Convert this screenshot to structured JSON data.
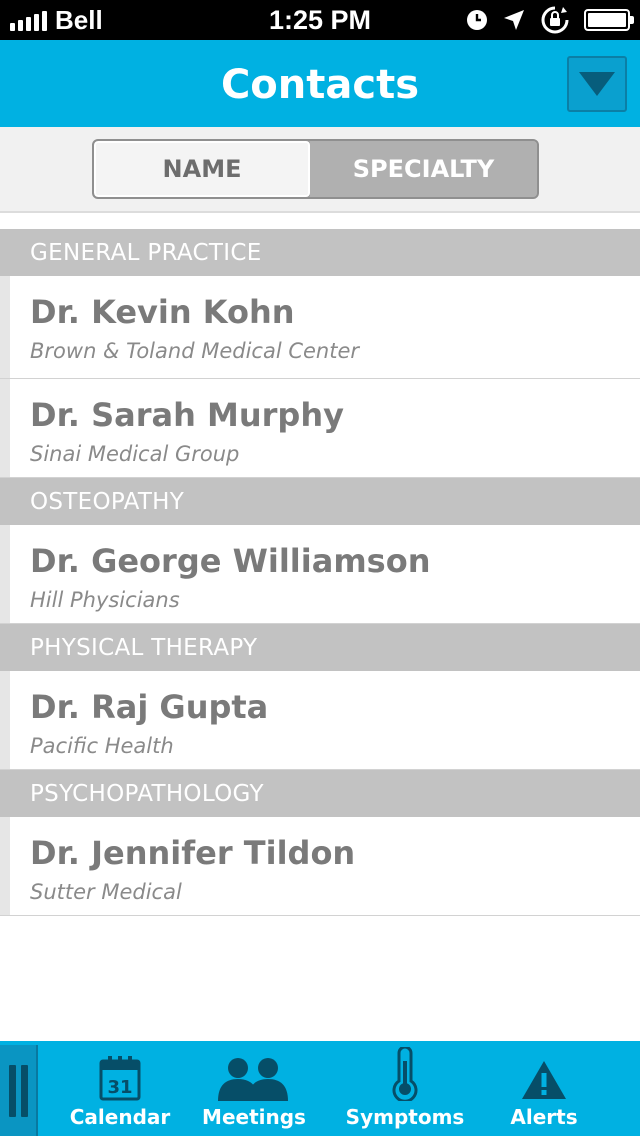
{
  "status_bar": {
    "carrier": "Bell",
    "time": "1:25 PM",
    "icons": [
      "signal-icon",
      "clock-icon",
      "location-arrow-icon",
      "rotation-lock-icon",
      "battery-icon"
    ]
  },
  "nav": {
    "title": "Contacts",
    "menu_icon": "dropdown-triangle-icon"
  },
  "segmented": {
    "options": [
      "NAME",
      "SPECIALTY"
    ],
    "selected": "NAME"
  },
  "contacts": [
    {
      "section": "GENERAL PRACTICE",
      "items": [
        {
          "name": "Dr. Kevin Kohn",
          "org": "Brown & Toland Medical Center"
        },
        {
          "name": "Dr. Sarah Murphy",
          "org": "Sinai Medical Group"
        }
      ]
    },
    {
      "section": "OSTEOPATHY",
      "items": [
        {
          "name": "Dr. George Williamson",
          "org": "Hill Physicians"
        }
      ]
    },
    {
      "section": "PHYSICAL THERAPY",
      "items": [
        {
          "name": "Dr. Raj Gupta",
          "org": "Pacific Health"
        }
      ]
    },
    {
      "section": "PSYCHOPATHOLOGY",
      "items": [
        {
          "name": "Dr. Jennifer Tildon",
          "org": "Sutter Medical"
        }
      ]
    }
  ],
  "tab_bar": {
    "tabs": [
      {
        "label": "Calendar",
        "icon": "calendar-icon",
        "icon_text": "31"
      },
      {
        "label": "Meetings",
        "icon": "people-icon"
      },
      {
        "label": "Symptoms",
        "icon": "thermometer-icon"
      },
      {
        "label": "Alerts",
        "icon": "warning-icon"
      }
    ]
  },
  "colors": {
    "accent": "#00b1e2",
    "section_header": "#c2c2c2",
    "text_gray": "#7a7a7a"
  }
}
